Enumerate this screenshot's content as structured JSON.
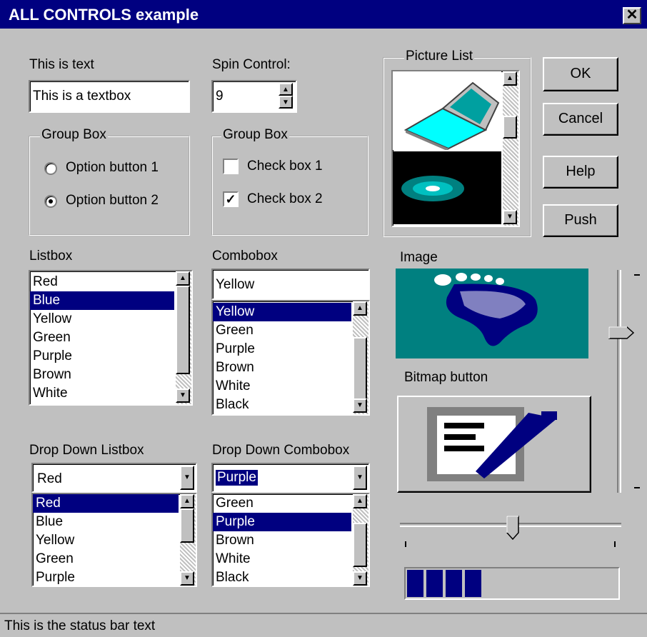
{
  "window": {
    "title": "ALL CONTROLS example",
    "close_glyph": "✕"
  },
  "text": {
    "label": "This is text",
    "value": "This is a textbox"
  },
  "spin": {
    "label": "Spin Control:",
    "value": "9"
  },
  "group1": {
    "title": "Group Box",
    "options": [
      "Option button 1",
      "Option button 2"
    ],
    "selected": 1
  },
  "group2": {
    "title": "Group Box",
    "checks": [
      "Check box 1",
      "Check box 2"
    ],
    "checked": [
      false,
      true
    ]
  },
  "picture_list": {
    "title": "Picture List"
  },
  "buttons": {
    "ok": "OK",
    "cancel": "Cancel",
    "help": "Help",
    "push": "Push"
  },
  "listbox": {
    "label": "Listbox",
    "items": [
      "Red",
      "Blue",
      "Yellow",
      "Green",
      "Purple",
      "Brown",
      "White"
    ],
    "selected": "Blue"
  },
  "combobox": {
    "label": "Combobox",
    "value": "Yellow",
    "items": [
      "Yellow",
      "Green",
      "Purple",
      "Brown",
      "White",
      "Black"
    ],
    "selected": "Yellow"
  },
  "image": {
    "label": "Image"
  },
  "bitmap": {
    "label": "Bitmap button"
  },
  "ddlist": {
    "label": "Drop Down Listbox",
    "value": "Red",
    "items": [
      "Red",
      "Blue",
      "Yellow",
      "Green",
      "Purple"
    ],
    "selected": "Red"
  },
  "ddcombo": {
    "label": "Drop Down Combobox",
    "value": "Purple",
    "items": [
      "Green",
      "Purple",
      "Brown",
      "White",
      "Black"
    ],
    "selected": "Purple"
  },
  "vslider": {
    "level": 0.27
  },
  "hslider": {
    "level": 0.51
  },
  "progress": {
    "segments": 4,
    "level": 0.27
  },
  "status": {
    "text": "This is the status bar text"
  },
  "colors": {
    "titlebar": "#000080",
    "face": "#c0c0c0",
    "selection": "#000080",
    "image_bg": "#008080",
    "picture_cyan": "#00ffff"
  }
}
